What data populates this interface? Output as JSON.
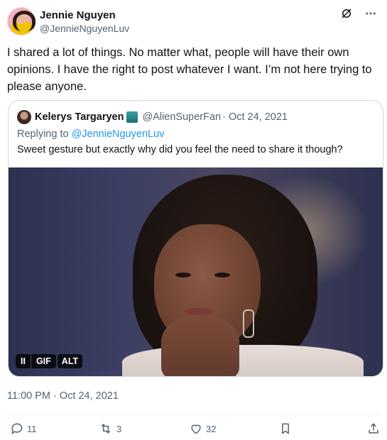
{
  "tweet": {
    "author_name": "Jennie Nguyen",
    "author_handle": "@JennieNguyenLuv",
    "text": "I shared a lot of things.  No matter what, people will have their own opinions.  I have the right to post whatever I want. I’m not here trying to please anyone.",
    "timestamp": "11:00 PM · Oct 24, 2021"
  },
  "quoted": {
    "author_name": "Kelerys Targaryen",
    "author_handle": "@AlienSuperFan",
    "date": "· Oct 24, 2021",
    "replying_prefix": "Replying to ",
    "replying_to": "@JennieNguyenLuv",
    "text": "Sweet gesture but exactly why did you feel the need to share it though?",
    "media": {
      "gif_label": "GIF",
      "alt_label": "ALT",
      "pause_label": "II"
    }
  },
  "actions": {
    "replies": "11",
    "reposts": "3",
    "likes": "32"
  },
  "icons": [
    "grok-icon",
    "more-icon",
    "reply-icon",
    "repost-icon",
    "like-icon",
    "bookmark-icon",
    "share-icon",
    "pause-icon"
  ],
  "colors": {
    "link": "#1d9bf0",
    "muted": "#536471",
    "text": "#0f1419",
    "border": "#cfd9de"
  }
}
